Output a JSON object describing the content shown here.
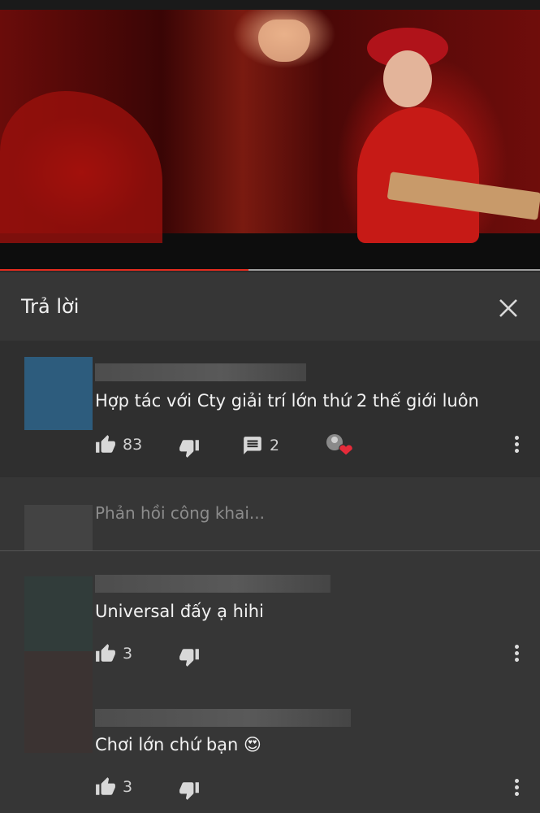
{
  "panel": {
    "title": "Trả lời",
    "close_icon": "close-icon"
  },
  "top_comment": {
    "text": "Hợp tác với Cty giải trí lớn thứ 2 thế giới luôn",
    "likes": "83",
    "replies": "2",
    "creator_heart_icon": "heart-icon"
  },
  "reply_input": {
    "placeholder": "Phản hồi công khai..."
  },
  "replies": [
    {
      "text": "Universal đấy ạ hihi",
      "likes": "3"
    },
    {
      "text": "Chơi lớn chứ bạn 😍",
      "likes": "3"
    }
  ],
  "video": {
    "progress_fraction": 0.46
  },
  "colors": {
    "progress": "#e32b1e",
    "panel_bg": "#363636",
    "heart": "#e62b3a"
  }
}
